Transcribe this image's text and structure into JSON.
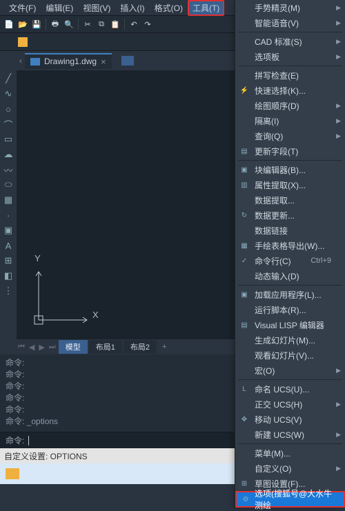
{
  "menubar": {
    "file": "文件(F)",
    "edit": "编辑(E)",
    "view": "视图(V)",
    "insert": "插入(I)",
    "format": "格式(O)",
    "tools": "工具(T)"
  },
  "filetab": {
    "name": "Drawing1.dwg"
  },
  "axes": {
    "x": "X",
    "y": "Y"
  },
  "tabs": {
    "model": "模型",
    "layout1": "布局1",
    "layout2": "布局2"
  },
  "cmdlog": [
    "命令:",
    "命令:",
    "命令:",
    "命令:",
    "命令:",
    "命令: _options"
  ],
  "cmdprompt": "命令:",
  "status": "自定义设置: OPTIONS",
  "dropdown": [
    {
      "t": "item",
      "label": "手势精灵(M)",
      "arrow": true
    },
    {
      "t": "item",
      "label": "智能语音(V)",
      "arrow": true
    },
    {
      "t": "sep"
    },
    {
      "t": "item",
      "label": "CAD 标准(S)",
      "arrow": true
    },
    {
      "t": "item",
      "label": "选项板",
      "arrow": true
    },
    {
      "t": "sep"
    },
    {
      "t": "item",
      "label": "拼写检查(E)"
    },
    {
      "t": "item",
      "label": "快速选择(K)...",
      "ico": "⚡",
      "icocls": "or"
    },
    {
      "t": "item",
      "label": "绘图顺序(D)",
      "arrow": true
    },
    {
      "t": "item",
      "label": "隔离(I)",
      "arrow": true
    },
    {
      "t": "item",
      "label": "查询(Q)",
      "arrow": true
    },
    {
      "t": "item",
      "label": "更新字段(T)",
      "ico": "▤"
    },
    {
      "t": "sep"
    },
    {
      "t": "item",
      "label": "块编辑器(B)...",
      "ico": "▣"
    },
    {
      "t": "item",
      "label": "属性提取(X)...",
      "ico": "▥"
    },
    {
      "t": "item",
      "label": "数据提取..."
    },
    {
      "t": "item",
      "label": "数据更新...",
      "ico": "↻"
    },
    {
      "t": "item",
      "label": "数据链接"
    },
    {
      "t": "item",
      "label": "手绘表格导出(W)...",
      "ico": "▦"
    },
    {
      "t": "item",
      "label": "命令行(C)",
      "sc": "Ctrl+9",
      "ico": "✓"
    },
    {
      "t": "item",
      "label": "动态输入(D)"
    },
    {
      "t": "sep"
    },
    {
      "t": "item",
      "label": "加载应用程序(L)...",
      "ico": "▣"
    },
    {
      "t": "item",
      "label": "运行脚本(R)..."
    },
    {
      "t": "item",
      "label": "Visual LISP 编辑器",
      "ico": "▤"
    },
    {
      "t": "item",
      "label": "生成幻灯片(M)..."
    },
    {
      "t": "item",
      "label": "观看幻灯片(V)..."
    },
    {
      "t": "item",
      "label": "宏(O)",
      "arrow": true
    },
    {
      "t": "sep"
    },
    {
      "t": "item",
      "label": "命名 UCS(U)...",
      "ico": "L"
    },
    {
      "t": "item",
      "label": "正交 UCS(H)",
      "arrow": true
    },
    {
      "t": "item",
      "label": "移动 UCS(V)",
      "ico": "✥"
    },
    {
      "t": "item",
      "label": "新建 UCS(W)",
      "arrow": true
    },
    {
      "t": "sep"
    },
    {
      "t": "item",
      "label": "菜单(M)..."
    },
    {
      "t": "item",
      "label": "自定义(O)",
      "arrow": true
    },
    {
      "t": "item",
      "label": "草图设置(F)...",
      "ico": "⊞"
    },
    {
      "t": "item",
      "label": "选项(搜狐号@大水牛测绘",
      "ico": "⚙",
      "hl": true
    }
  ]
}
